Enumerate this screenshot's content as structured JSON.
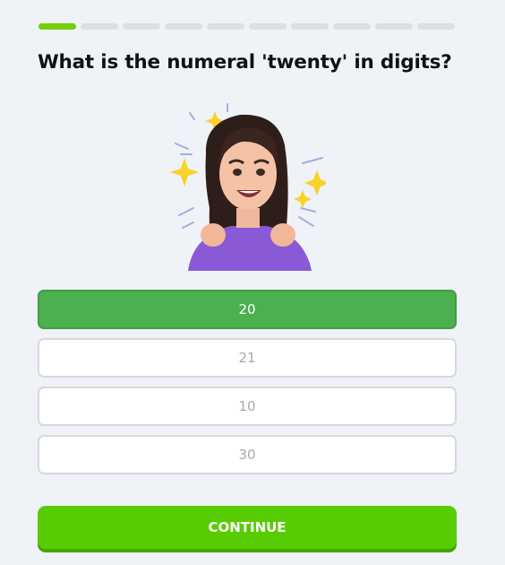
{
  "progress": {
    "total_steps": 10,
    "completed_steps": 1
  },
  "question": {
    "text": "What is the numeral 'twenty' in digits?"
  },
  "illustration": {
    "icon": "excited-avatar-sticker"
  },
  "options": [
    {
      "label": "20",
      "selected": true
    },
    {
      "label": "21",
      "selected": false
    },
    {
      "label": "10",
      "selected": false
    },
    {
      "label": "30",
      "selected": false
    }
  ],
  "continue_button": {
    "label": "CONTINUE"
  },
  "colors": {
    "progress_done": "#71cf06",
    "progress_todo": "#dedfe1",
    "selected_option": "#4caf50",
    "continue_button": "#58cc02",
    "background": "#eff2f7"
  }
}
